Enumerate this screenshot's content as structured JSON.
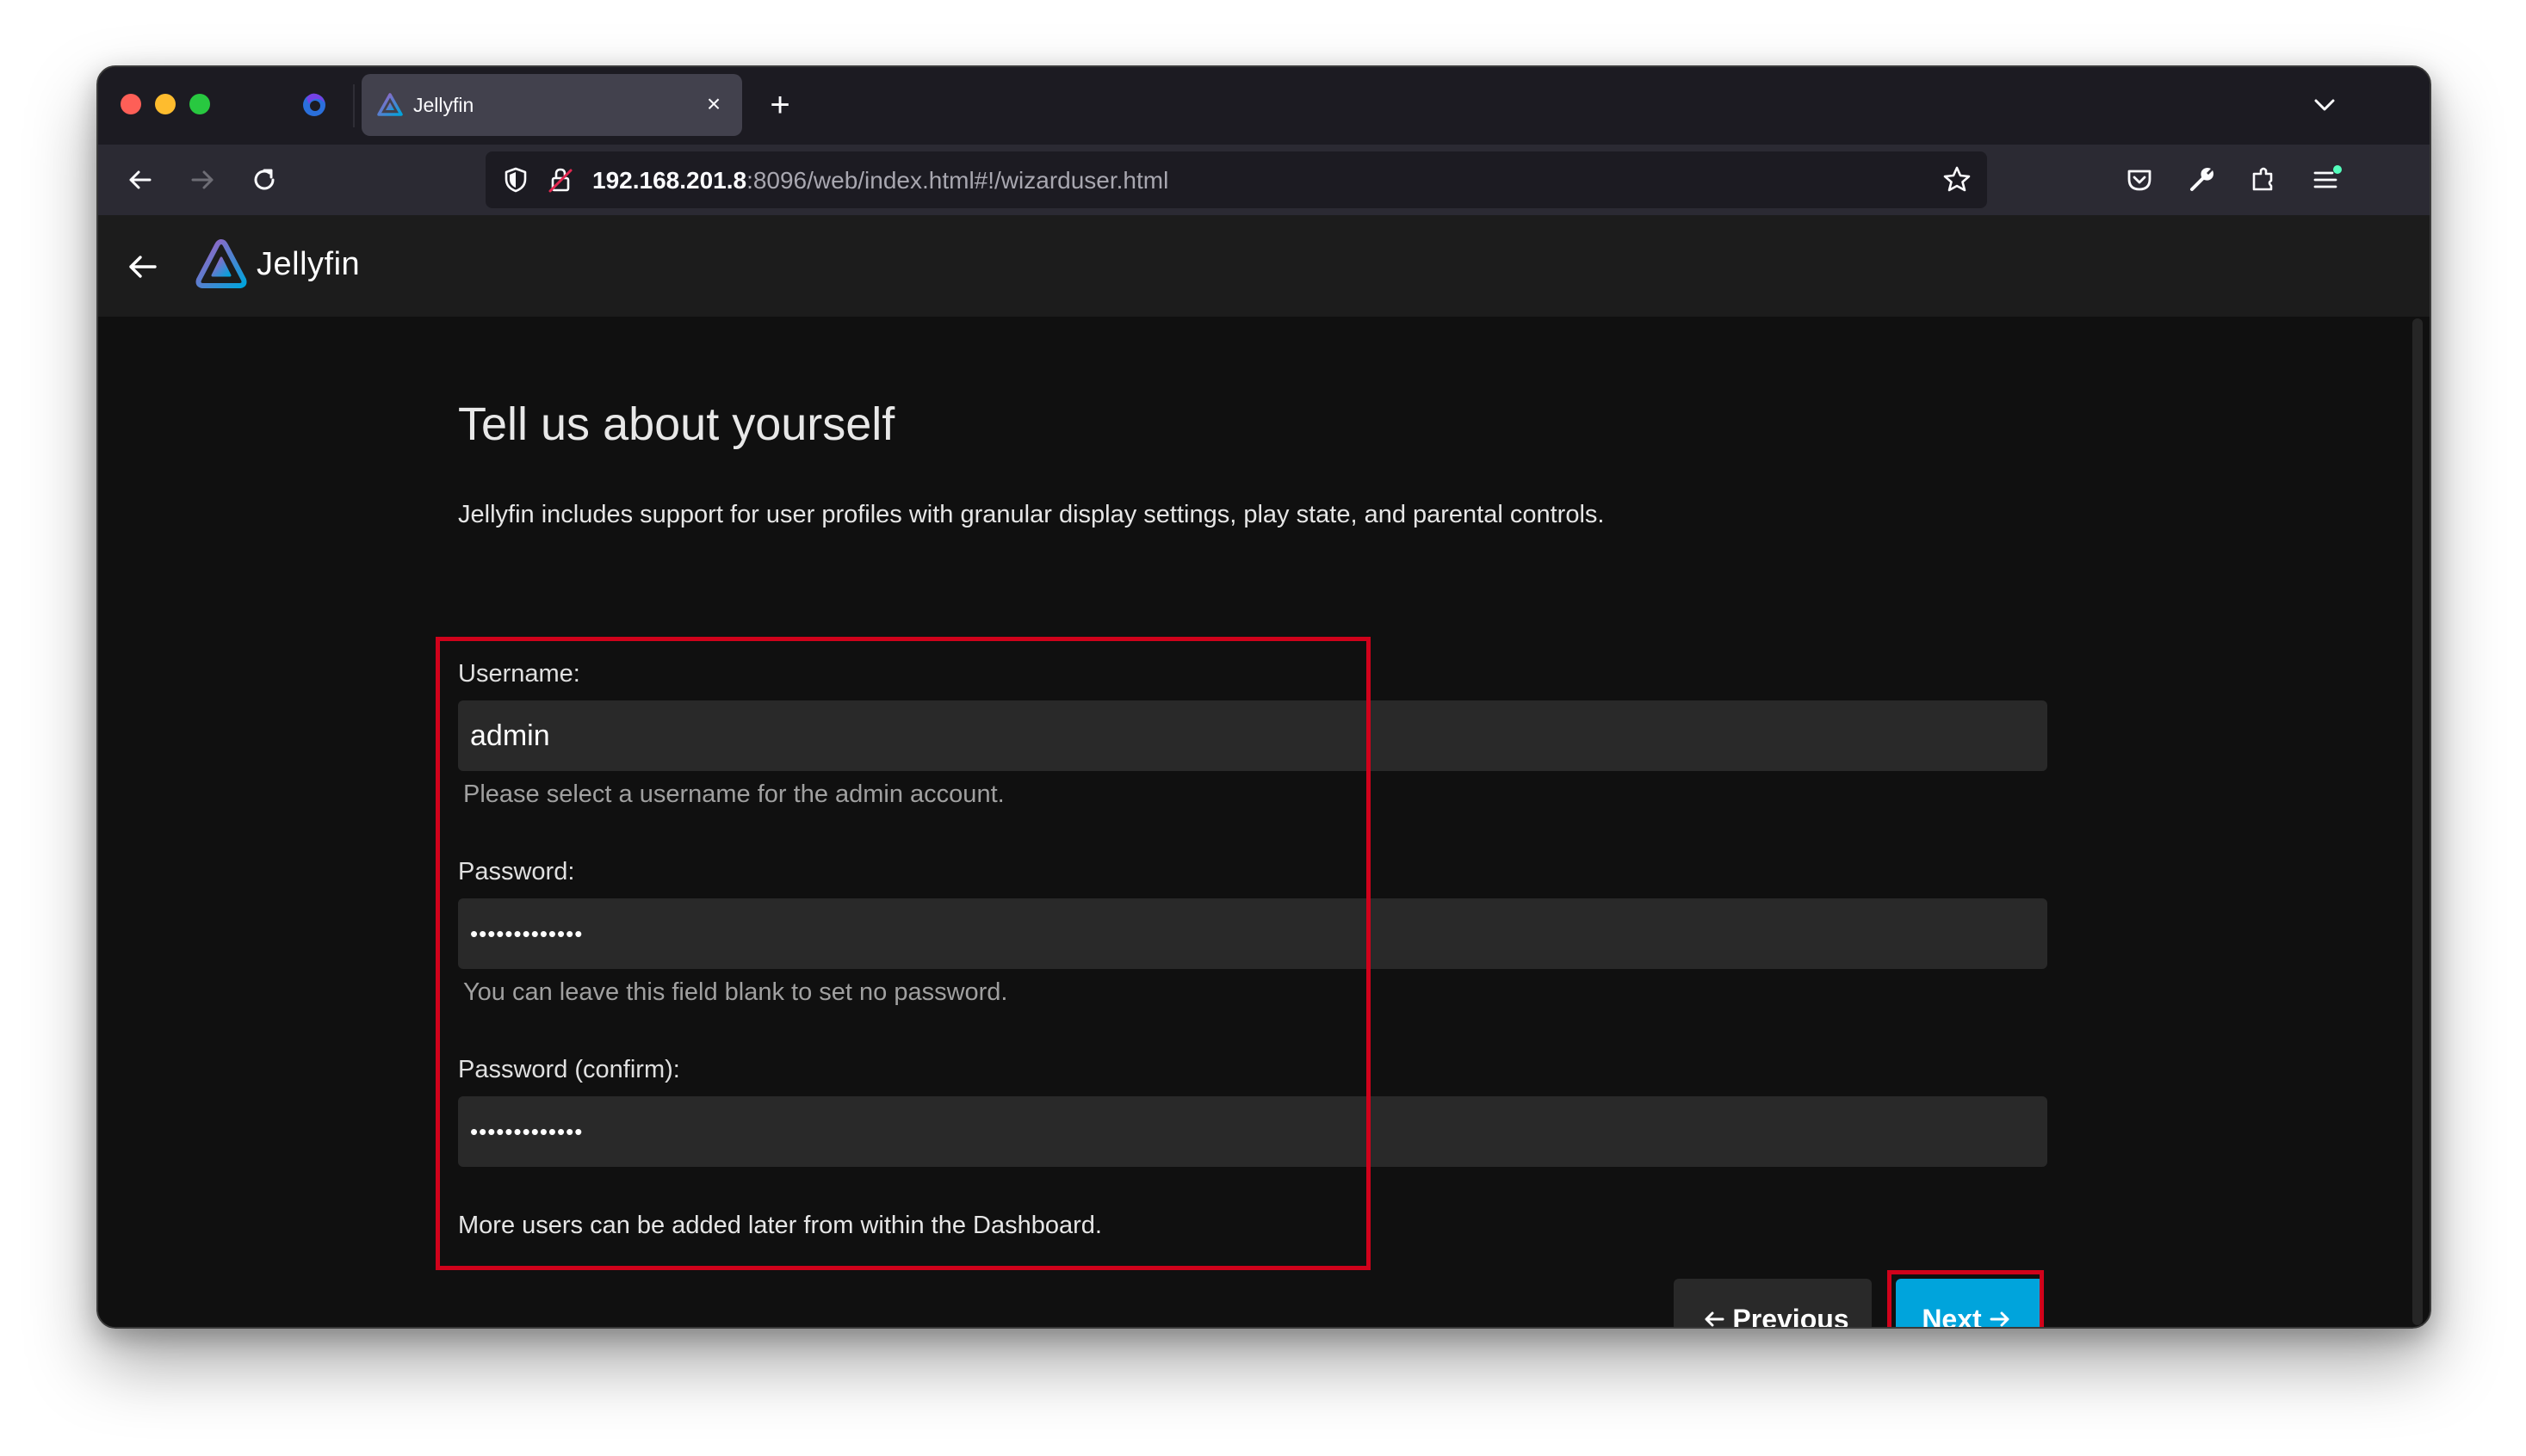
{
  "browser": {
    "tab_title": "Jellyfin",
    "url_host": "192.168.201.8",
    "url_rest": ":8096/web/index.html#!/wizarduser.html"
  },
  "app": {
    "name": "Jellyfin"
  },
  "wizard": {
    "title": "Tell us about yourself",
    "intro": "Jellyfin includes support for user profiles with granular display settings, play state, and parental controls.",
    "username": {
      "label": "Username:",
      "value": "admin",
      "help": "Please select a username for the admin account."
    },
    "password": {
      "label": "Password:",
      "value": "•••••••••••••",
      "help": "You can leave this field blank to set no password."
    },
    "password_confirm": {
      "label": "Password (confirm):",
      "value": "•••••••••••••"
    },
    "footnote": "More users can be added later from within the Dashboard.",
    "previous_label": "Previous",
    "next_label": "Next"
  },
  "colors": {
    "accent": "#00a4dc",
    "highlight": "#d0021b",
    "logo_purple": "#aa5cc3",
    "logo_blue": "#00a4dc"
  },
  "icons": {
    "back": "arrow-left-icon",
    "forward": "arrow-right-icon",
    "reload": "reload-icon",
    "shield": "shield-icon",
    "lock": "lock-icon",
    "star": "star-icon",
    "pocket": "pocket-icon",
    "tools": "wrench-icon",
    "extensions": "extensions-icon",
    "menu": "menu-icon"
  }
}
